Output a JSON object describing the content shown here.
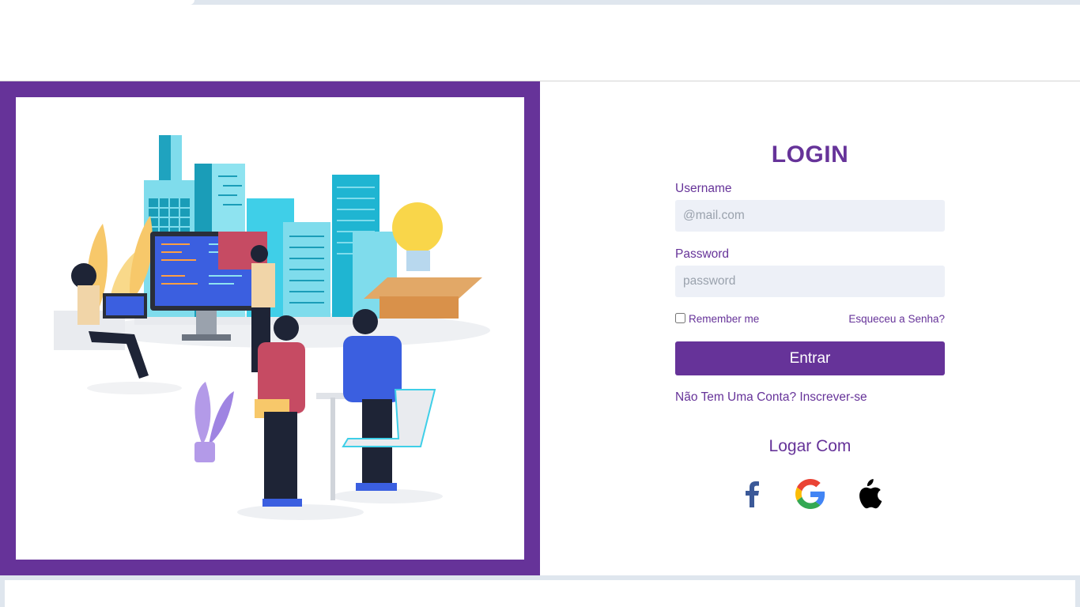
{
  "login": {
    "title": "LOGIN",
    "username_label": "Username",
    "username_placeholder": "@mail.com",
    "password_label": "Password",
    "password_placeholder": "password",
    "remember_label": "Remember me",
    "forgot_link": "Esqueceu a Senha?",
    "submit_label": "Entrar",
    "signup_link": "Não Tem Uma Conta? Inscrever-se",
    "social_title": "Logar Com"
  },
  "social": [
    {
      "icon": "facebook-icon",
      "color": "#3b5998"
    },
    {
      "icon": "google-icon",
      "colors": [
        "#4285F4",
        "#EA4335",
        "#FBBC05",
        "#34A853"
      ]
    },
    {
      "icon": "apple-icon",
      "color": "#000000"
    }
  ],
  "colors": {
    "brand": "#663399",
    "input_bg": "#edf0f7"
  }
}
